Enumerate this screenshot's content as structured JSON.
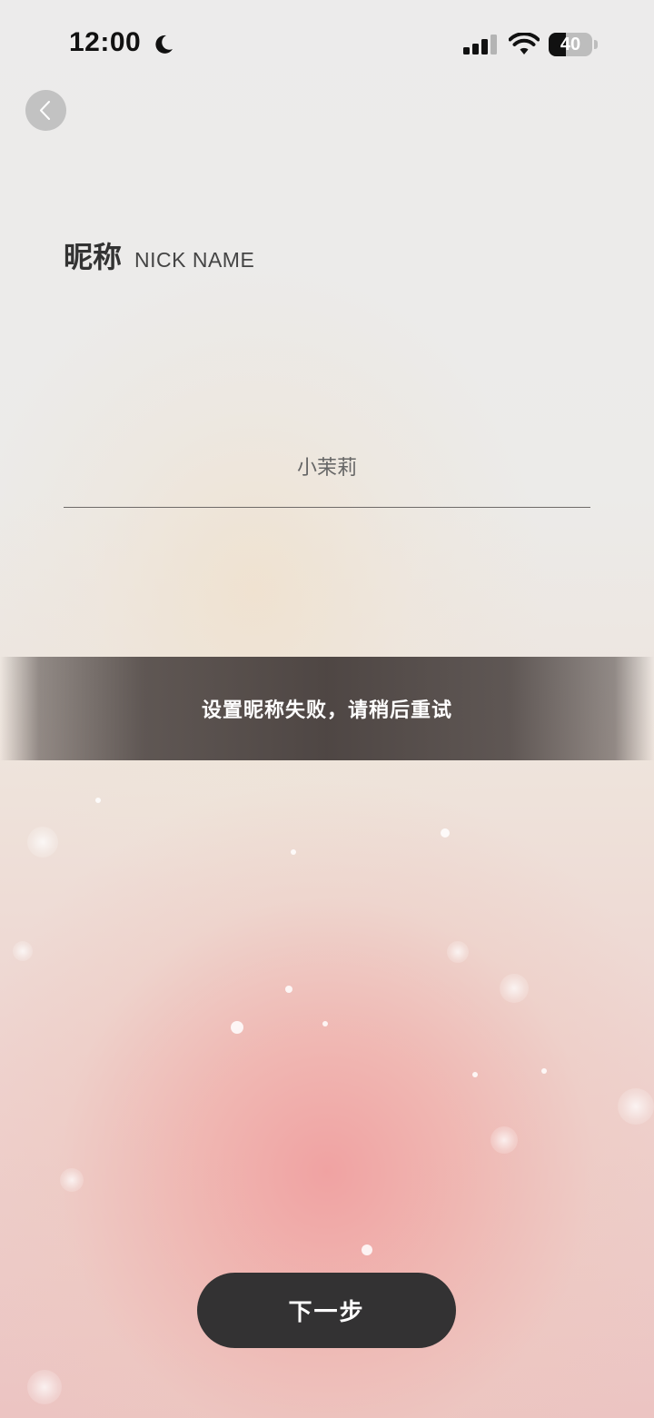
{
  "status_bar": {
    "time": "12:00",
    "focus_mode_icon": "moon-icon",
    "signal_icon": "cellular-signal-icon",
    "wifi_icon": "wifi-icon",
    "battery_level": "40",
    "battery_fraction": 0.4
  },
  "nav": {
    "back_icon": "chevron-left-icon"
  },
  "header": {
    "title_cn": "昵称",
    "title_en": "NICK NAME"
  },
  "form": {
    "nickname_value": "小茉莉"
  },
  "toast": {
    "message": "设置昵称失败，请稍后重试"
  },
  "actions": {
    "next_label": "下一步"
  },
  "colors": {
    "button_bg": "#333233",
    "toast_bg": "#463e3c",
    "title_text": "#333333",
    "accent_pink": "#f0a0a0"
  }
}
